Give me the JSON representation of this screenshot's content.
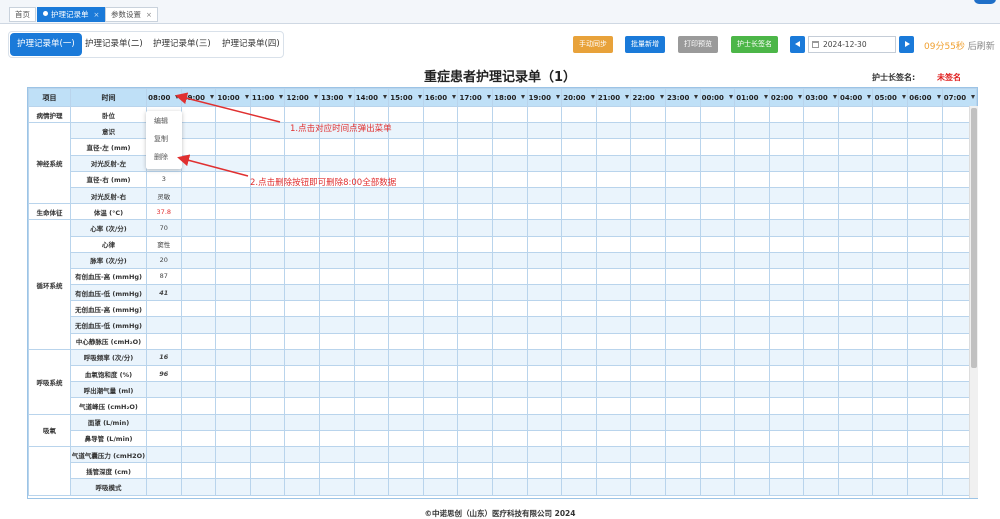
{
  "top_tabs": [
    {
      "label": "首页"
    },
    {
      "label": "护理记录单",
      "close": "×"
    },
    {
      "label": "参数设置",
      "close": "×"
    }
  ],
  "sub_tabs": [
    "护理记录单(一)",
    "护理记录单(二)",
    "护理记录单(三)",
    "护理记录单(四)"
  ],
  "toolbar": {
    "manual_sync": "手动同步",
    "batch_add": "批量新增",
    "print_preview": "打印预览",
    "head_nurse_sign": "护士长签名",
    "date": "2024-12-30",
    "refresh_countdown": "09分55秒",
    "refresh_suffix": "后刷新"
  },
  "title": "重症患者护理记录单（1）",
  "sign": {
    "label": "护士长签名:",
    "value": "未签名"
  },
  "table": {
    "header_item": "项目",
    "header_time": "时间",
    "times": [
      "08:00",
      "09:00",
      "10:00",
      "11:00",
      "12:00",
      "13:00",
      "14:00",
      "15:00",
      "16:00",
      "17:00",
      "18:00",
      "19:00",
      "20:00",
      "21:00",
      "22:00",
      "23:00",
      "00:00",
      "01:00",
      "02:00",
      "03:00",
      "04:00",
      "05:00",
      "06:00",
      "07:00"
    ],
    "groups": [
      {
        "name": "病情护理",
        "rows": [
          {
            "label": "卧位",
            "value": ""
          }
        ]
      },
      {
        "name": "神经系统",
        "rows": [
          {
            "label": "意识",
            "value": ""
          },
          {
            "label": "直径-左 (mm)",
            "value": ""
          },
          {
            "label": "对光反射-左",
            "value": ""
          },
          {
            "label": "直径-右 (mm)",
            "value": "3"
          },
          {
            "label": "对光反射-右",
            "value": "灵敏"
          }
        ]
      },
      {
        "name": "生命体征",
        "rows": [
          {
            "label": "体温 (°C)",
            "value": "37.8"
          }
        ]
      },
      {
        "name": "循环系统",
        "rows": [
          {
            "label": "心率 (次/分)",
            "value": "70"
          },
          {
            "label": "心律",
            "value": "窦性"
          },
          {
            "label": "脉率 (次/分)",
            "value": "20"
          },
          {
            "label": "有创血压-高 (mmHg)",
            "value": "87"
          },
          {
            "label": "有创血压-低 (mmHg)",
            "value": "41"
          },
          {
            "label": "无创血压-高 (mmHg)",
            "value": ""
          },
          {
            "label": "无创血压-低 (mmHg)",
            "value": ""
          },
          {
            "label": "中心静脉压 (cmH₂O)",
            "value": ""
          }
        ]
      },
      {
        "name": "呼吸系统",
        "rows": [
          {
            "label": "呼吸频率 (次/分)",
            "value": "16"
          },
          {
            "label": "血氧饱和度 (%)",
            "value": "96"
          },
          {
            "label": "呼出潮气量 (ml)",
            "value": ""
          },
          {
            "label": "气道峰压 (cmH₂O)",
            "value": ""
          }
        ]
      },
      {
        "name": "吸氧",
        "rows": [
          {
            "label": "面罩 (L/min)",
            "value": ""
          },
          {
            "label": "鼻导管 (L/min)",
            "value": ""
          }
        ]
      },
      {
        "name": "",
        "rows": [
          {
            "label": "气道气囊压力 (cmH2O)",
            "value": ""
          },
          {
            "label": "插管深度 (cm)",
            "value": ""
          },
          {
            "label": "呼吸模式",
            "value": ""
          }
        ]
      }
    ]
  },
  "context_menu": [
    "编辑",
    "复制",
    "删除"
  ],
  "annotations": {
    "step1": "1.点击对应时间点弹出菜单",
    "step2": "2.点击删除按钮即可删除8:00全部数据"
  },
  "colors": {
    "accent": "#1a7ad9",
    "orange": "#e8a23a",
    "green": "#4cb648",
    "gray": "#9a9a9a",
    "alert": "#e03030"
  },
  "footer": "©中诺思创（山东）医疗科技有限公司 2024"
}
